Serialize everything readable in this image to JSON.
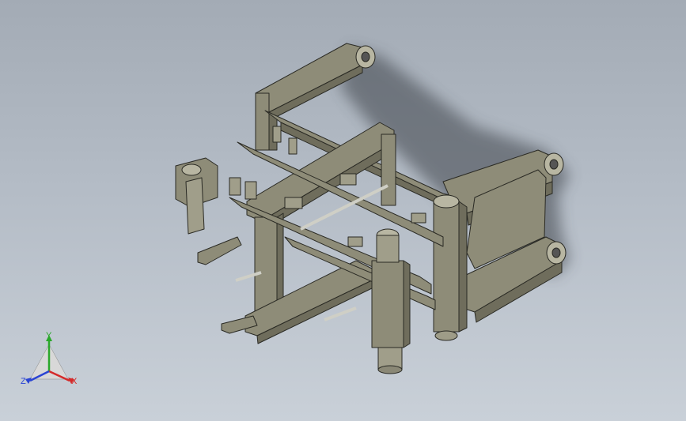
{
  "viewport": {
    "background_top": "#a3abb5",
    "background_bottom": "#c9d0d8"
  },
  "model": {
    "name": "machine-assembly-isometric",
    "body_color": "#8e8c78",
    "edge_color": "#2a2a24",
    "shadow_color": "#3c4248"
  },
  "triad": {
    "x_label": "X",
    "y_label": "Y",
    "z_label": "Z",
    "x_color": "#d42a2a",
    "y_color": "#2aa82a",
    "z_color": "#2a44d4"
  }
}
